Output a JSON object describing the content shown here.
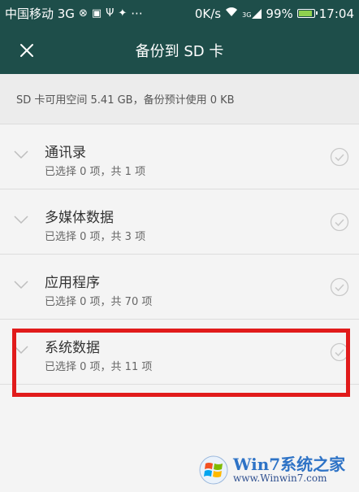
{
  "status_bar": {
    "carrier": "中国移动 3G",
    "dots": "···",
    "net_speed": "0K/s",
    "signal_label": "3G",
    "battery_pct": "99%",
    "time": "17:04"
  },
  "header": {
    "title": "备份到 SD 卡",
    "close_icon": "close-icon"
  },
  "info": {
    "text": "SD 卡可用空间 5.41 GB，备份预计使用 0 KB"
  },
  "items": [
    {
      "title": "通讯录",
      "subtitle": "已选择 0 项，共 1 项"
    },
    {
      "title": "多媒体数据",
      "subtitle": "已选择 0 项，共 3 项"
    },
    {
      "title": "应用程序",
      "subtitle": "已选择 0 项，共 70 项"
    },
    {
      "title": "系统数据",
      "subtitle": "已选择 0 项，共 11 项"
    }
  ],
  "watermark": {
    "brand": "Win7系统之家",
    "url": "www.Winwin7.com"
  },
  "colors": {
    "header_bg": "#1e4e4a",
    "highlight": "#e11b1b",
    "background": "#f4f4f4"
  }
}
